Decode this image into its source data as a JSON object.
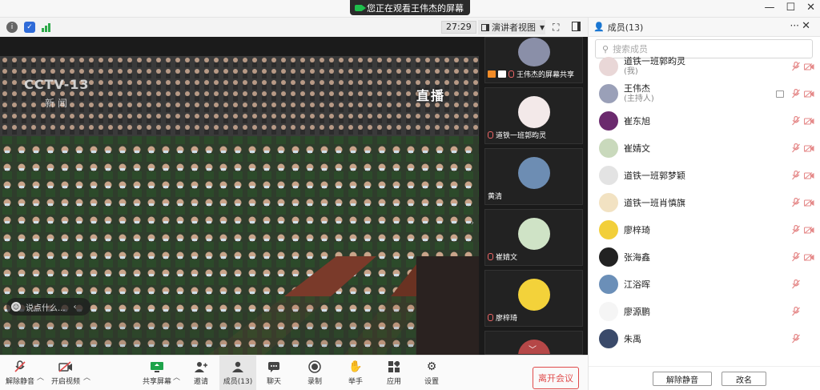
{
  "banner": {
    "text": "您正在观看王伟杰的屏幕"
  },
  "window": {
    "minimize": "—",
    "maximize": "☐",
    "close": "✕"
  },
  "toolbar": {
    "timer": "27:29",
    "view_label": "演讲者视图"
  },
  "video": {
    "channel_logo": "CCTV-13",
    "channel_sub": "新闻",
    "live_label": "直播",
    "chat_placeholder": "说点什么..."
  },
  "thumbnails": [
    {
      "name": "王伟杰的屏幕共享",
      "color": "#8a8fa8"
    },
    {
      "name": "道铁一班郭昀灵",
      "color": "#f3e9e9"
    },
    {
      "name": "黄清",
      "color": "#6d8db3"
    },
    {
      "name": "崔婧文",
      "color": "#cfe3c6"
    },
    {
      "name": "廖梓琦",
      "color": "#f3d23a"
    },
    {
      "name": "",
      "color": "#b54747"
    }
  ],
  "bottom": {
    "unmute": "解除静音",
    "start_video": "开启视频",
    "share_screen": "共享屏幕",
    "invite": "邀请",
    "members": "成员(13)",
    "chat": "聊天",
    "record": "录制",
    "raise_hand": "举手",
    "apps": "应用",
    "settings": "设置",
    "leave": "离开会议"
  },
  "panel": {
    "title": "成员(13)",
    "search_placeholder": "搜索成员",
    "unmute_all": "解除静音",
    "rename": "改名",
    "members": [
      {
        "name": "道铁一班郭昀灵",
        "role": "(我)",
        "color": "#e9d7d7",
        "mic": true,
        "cam": true,
        "screen": false
      },
      {
        "name": "王伟杰",
        "role": "(主持人)",
        "color": "#9aa0b8",
        "mic": true,
        "cam": true,
        "screen": true
      },
      {
        "name": "崔东旭",
        "role": "",
        "color": "#6b2a6e",
        "mic": true,
        "cam": true,
        "screen": false
      },
      {
        "name": "崔婧文",
        "role": "",
        "color": "#c9d9bc",
        "mic": true,
        "cam": true,
        "screen": false
      },
      {
        "name": "道铁一班郭梦颖",
        "role": "",
        "color": "#e3e3e3",
        "mic": true,
        "cam": true,
        "screen": false
      },
      {
        "name": "道铁一班肖慎旗",
        "role": "",
        "color": "#f2e2c2",
        "mic": true,
        "cam": true,
        "screen": false
      },
      {
        "name": "廖梓琦",
        "role": "",
        "color": "#f2cf3a",
        "mic": true,
        "cam": true,
        "screen": false
      },
      {
        "name": "张海鑫",
        "role": "",
        "color": "#222222",
        "mic": true,
        "cam": true,
        "screen": false
      },
      {
        "name": "江浴晖",
        "role": "",
        "color": "#6b8fb8",
        "mic": true,
        "cam": false,
        "screen": false
      },
      {
        "name": "廖源鹏",
        "role": "",
        "color": "#f5f5f5",
        "mic": true,
        "cam": false,
        "screen": false
      },
      {
        "name": "朱禹",
        "role": "",
        "color": "#3a4a6a",
        "mic": true,
        "cam": false,
        "screen": false
      }
    ]
  }
}
